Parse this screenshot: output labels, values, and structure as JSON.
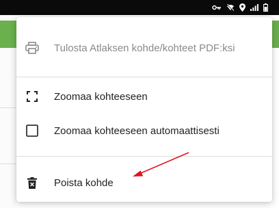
{
  "colors": {
    "status_bar": "#0a0a0a",
    "accent_green": "#6ab04c",
    "annotation_arrow": "#e0141e",
    "disabled_text": "#8a8a8a"
  },
  "status_bar": {
    "icons": [
      "key-icon",
      "wifi-off-icon",
      "location-icon",
      "signal-icon",
      "battery-icon"
    ]
  },
  "menu": {
    "items": [
      {
        "label": "Tulosta Atlaksen kohde/kohteet PDF:ksi",
        "icon": "print-icon",
        "enabled": false
      },
      {
        "label": "Zoomaa kohteeseen",
        "icon": "zoom-frame-icon",
        "enabled": true
      },
      {
        "label": "Zoomaa kohteeseen automaattisesti",
        "icon": "checkbox-icon",
        "checked": false,
        "enabled": true
      },
      {
        "label": "Poista kohde",
        "icon": "trash-icon",
        "enabled": true
      }
    ]
  },
  "annotation": {
    "type": "red-arrow",
    "target": "Poista kohde"
  }
}
